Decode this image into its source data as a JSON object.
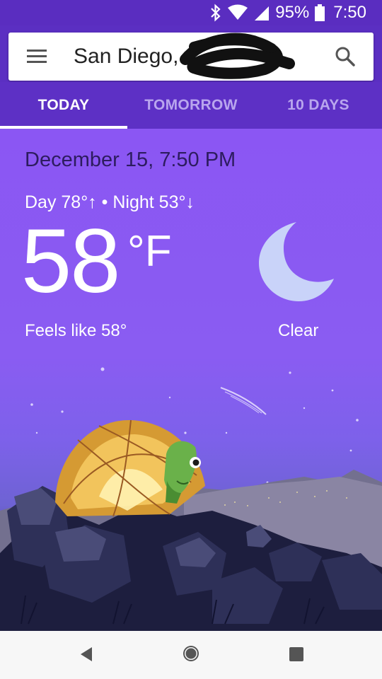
{
  "status_bar": {
    "battery": "95%",
    "time": "7:50",
    "icons": [
      "bluetooth-icon",
      "wifi-icon",
      "signal-icon",
      "battery-icon"
    ]
  },
  "search": {
    "location": "San Diego, C",
    "menu_icon": "menu-icon",
    "search_icon": "search-icon"
  },
  "tabs": [
    {
      "label": "TODAY",
      "active": true
    },
    {
      "label": "TOMORROW",
      "active": false
    },
    {
      "label": "10 DAYS",
      "active": false
    }
  ],
  "weather": {
    "datetime": "December 15, 7:50 PM",
    "day_night": "Day 78°↑ • Night 53°↓",
    "temperature": "58",
    "unit": "°F",
    "feels_like": "Feels like 58°",
    "condition": "Clear",
    "condition_icon": "moon-icon"
  },
  "nav_bar": {
    "back": "back-icon",
    "home": "home-icon",
    "recents": "recents-icon"
  },
  "colors": {
    "header": "#5d30c5",
    "sky_top": "#8b56f3",
    "moon": "#c9d3f9",
    "date_text": "#2d1c5f"
  }
}
